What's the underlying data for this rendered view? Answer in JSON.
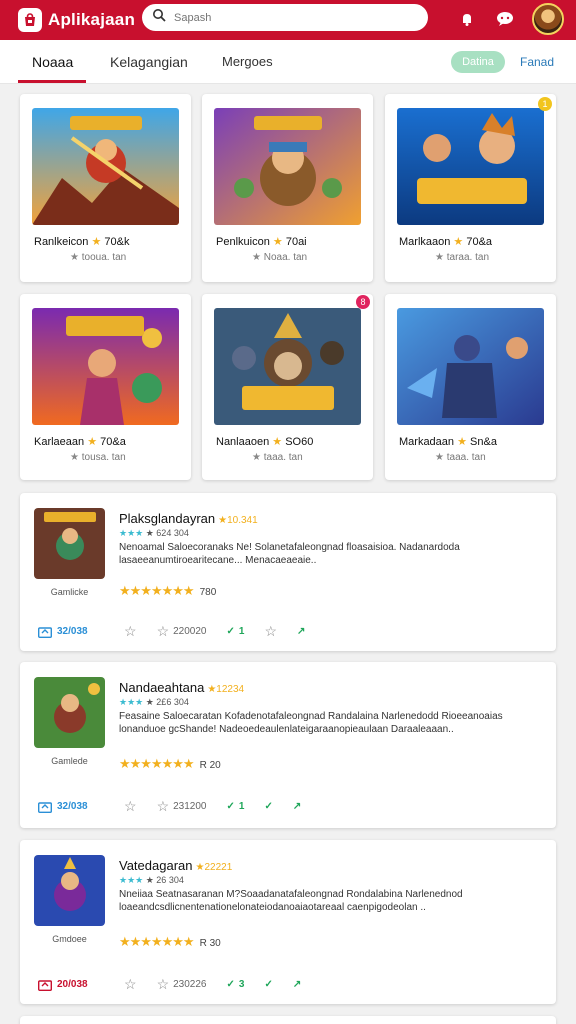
{
  "header": {
    "app_name": "Aplikajaan",
    "search_placeholder": "Sapash"
  },
  "tabs": [
    {
      "label": "Noaaa"
    },
    {
      "label": "Kelagangian"
    },
    {
      "label": "Mergoes"
    }
  ],
  "pill_label": "Datina",
  "link_label": "Fanad",
  "grid_cards": [
    {
      "title": "Ranlkeicon",
      "star": "★",
      "score": "70&k",
      "meta_star": "★",
      "meta": "tooua. tan",
      "badge": ""
    },
    {
      "title": "Penlkuicon",
      "star": "★",
      "score": "70ai",
      "meta_star": "★",
      "meta": "Noaa. tan",
      "badge": ""
    },
    {
      "title": "Marlkaaon",
      "star": "★",
      "score": "70&a",
      "meta_star": "★",
      "meta": "taraa. tan",
      "badge": "1"
    },
    {
      "title": "Karlaeaan",
      "star": "★",
      "score": "70&a",
      "meta_star": "★",
      "meta": "tousa. tan",
      "badge": ""
    },
    {
      "title": "Nanlaaoen",
      "star": "★",
      "score": "SO60",
      "meta_star": "★",
      "meta": "taaa. tan",
      "badge": "8"
    },
    {
      "title": "Markadaan",
      "star": "★",
      "score": "Sn&a",
      "meta_star": "★",
      "meta": "taaa. tan",
      "badge": ""
    }
  ],
  "list_items": [
    {
      "name": "Plaksglandayran",
      "tag": "★10.341",
      "sub_stars": "★★★",
      "sub": "★ 624 304",
      "desc": "Nenoamal Saloecoranaks Ne! Solanetafaleongnad floasaisioa. Nadanardoda lasaeeanumtiroearitecane... Menacaeaeaie..",
      "caption": "Gamlicke",
      "stars": "★★★★★★★",
      "rating": "780",
      "foot_main": "32/038",
      "foot_stat": "220020",
      "foot_g1": "1",
      "foot_g2": "",
      "foot_main_color": "#2a8fd6"
    },
    {
      "name": "Nandaeahtana",
      "tag": "★12234",
      "sub_stars": "★★★",
      "sub": "★ 2£6 304",
      "desc": "Feasaine Saloecaratan Kofadenotafaleongnad Randalaina Narlenedodd Rioeeanoaias lonanduoe gcShande! Nadeoedeaulenlateigaraanopieaulaan Daraaleaaan..",
      "caption": "Gamlede",
      "stars": "★★★★★★★",
      "rating": "R 20",
      "foot_main": "32/038",
      "foot_stat": "231200",
      "foot_g1": "1",
      "foot_g2": "1",
      "foot_main_color": "#2a8fd6"
    },
    {
      "name": "Vatedagaran",
      "tag": "★22221",
      "sub_stars": "★★★",
      "sub": "★ 26 304",
      "desc": "Nneiiaa Seatnasaranan M?Soaadanatafaleongnad Rondalabina Narlenednod loaeandcsdlicnentenationelonateiodanoaiaotareaal caenpigodeolan ..",
      "caption": "Gmdoee",
      "stars": "★★★★★★★",
      "rating": "R 30",
      "foot_main": "20/038",
      "foot_stat": "230226",
      "foot_g1": "3",
      "foot_g2": "1",
      "foot_main_color": "#c8102e"
    }
  ]
}
